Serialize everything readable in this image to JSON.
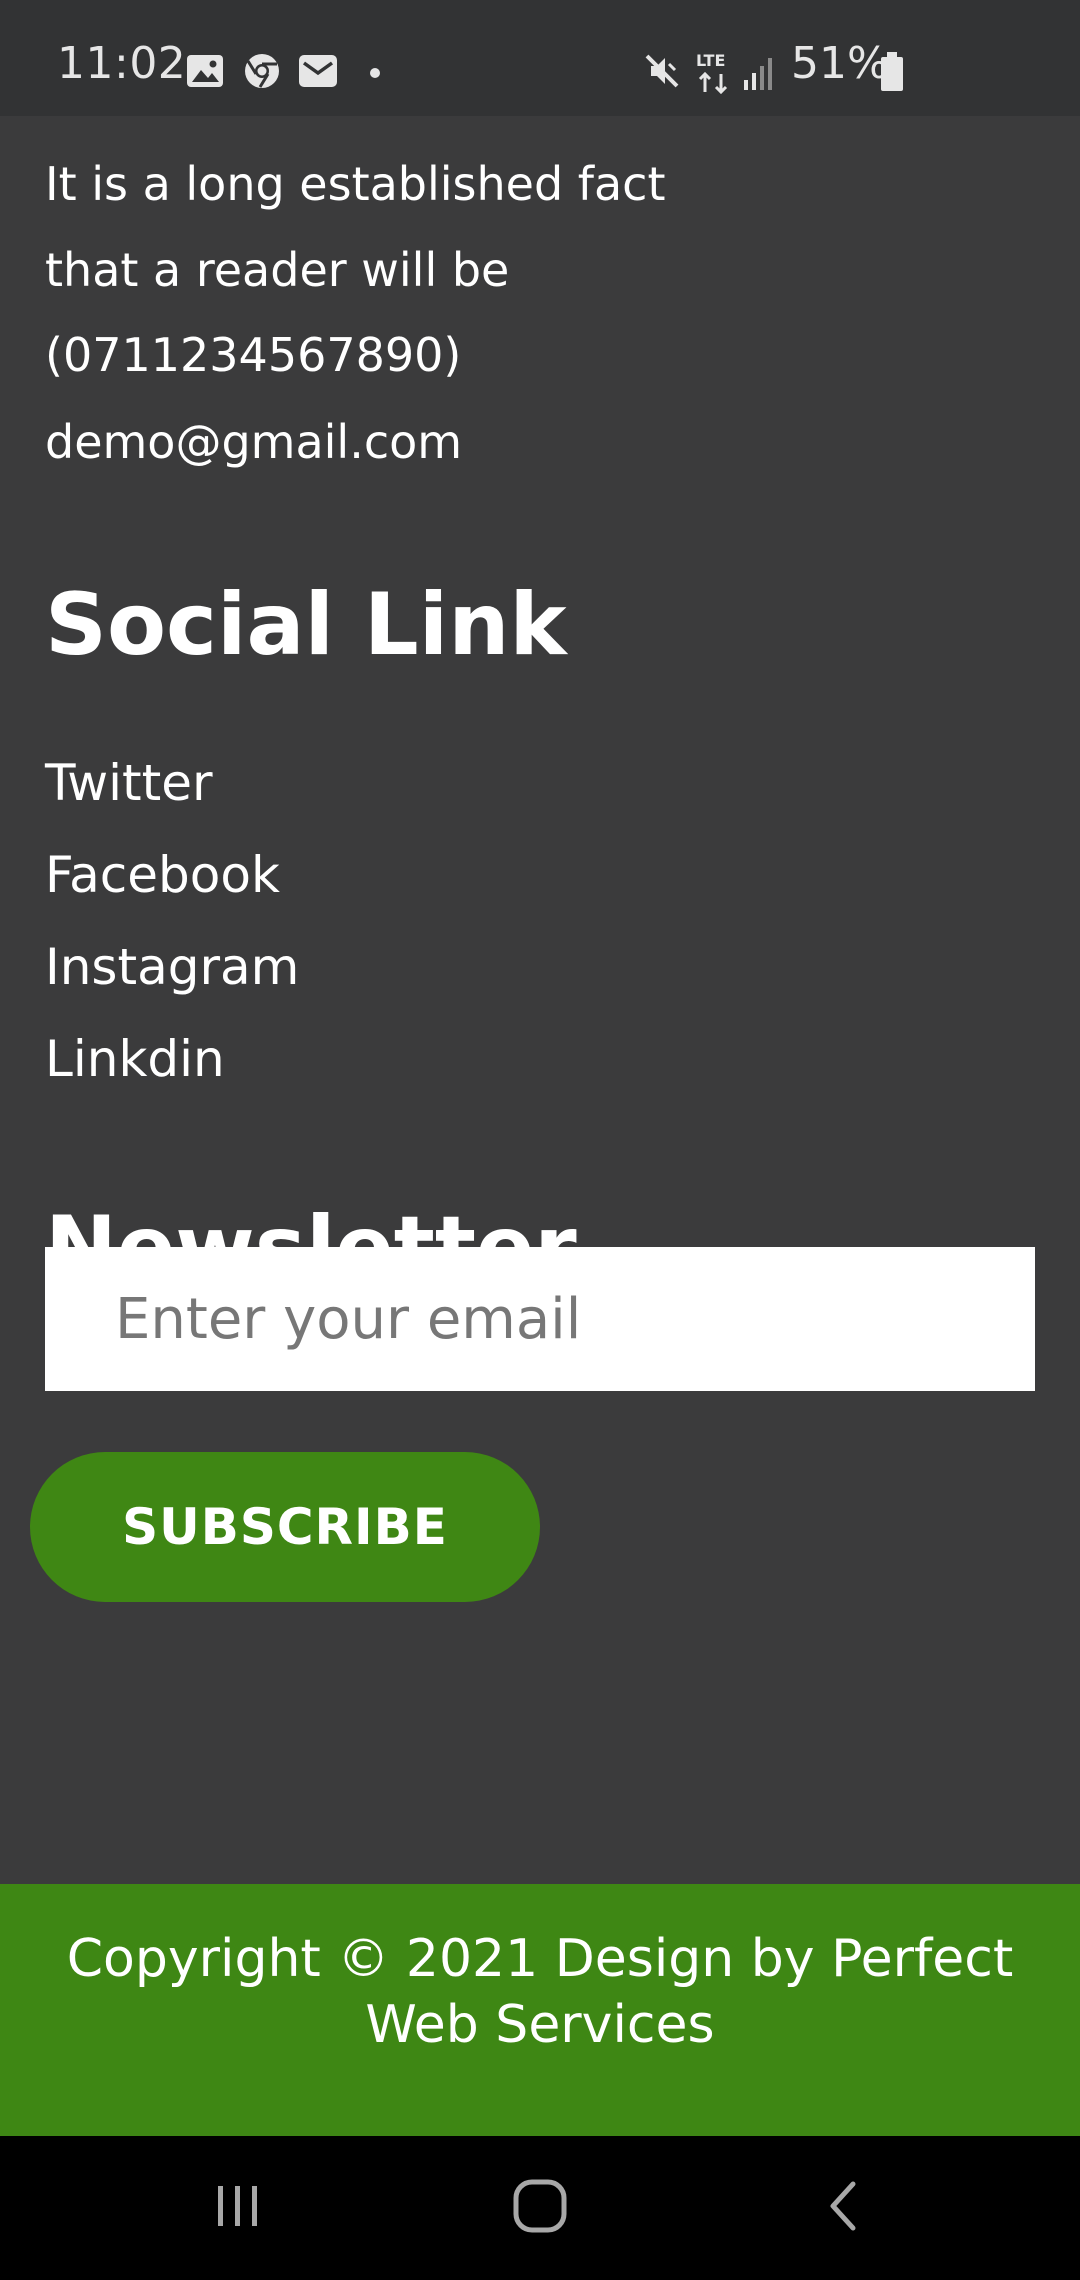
{
  "status_bar": {
    "time": "11:02",
    "battery": "51%",
    "icons": [
      "image-icon",
      "chrome-icon",
      "mail-icon",
      "dot-icon",
      "mute-icon",
      "lte-icon",
      "signal-icon",
      "battery-icon"
    ]
  },
  "contact": {
    "line1": "It is a long established fact",
    "line2": "that a reader will be",
    "phone": "(0711234567890)",
    "email": "demo@gmail.com"
  },
  "social": {
    "title": "Social Link",
    "links": [
      "Twitter",
      "Facebook",
      "Instagram",
      "Linkdin"
    ]
  },
  "newsletter": {
    "title": "Newsletter",
    "email_placeholder": "Enter your email",
    "email_value": "",
    "subscribe_label": "SUBSCRIBE"
  },
  "footer": {
    "line1": "Copyright © 2021 Design by Perfect",
    "line2": "Web Services"
  },
  "colors": {
    "background": "#3b3b3c",
    "status_bar": "#323334",
    "accent_green": "#3f8714",
    "nav_bar": "#000000"
  },
  "nav_bar": {
    "icons": [
      "recent-apps-icon",
      "home-icon",
      "back-icon"
    ]
  }
}
